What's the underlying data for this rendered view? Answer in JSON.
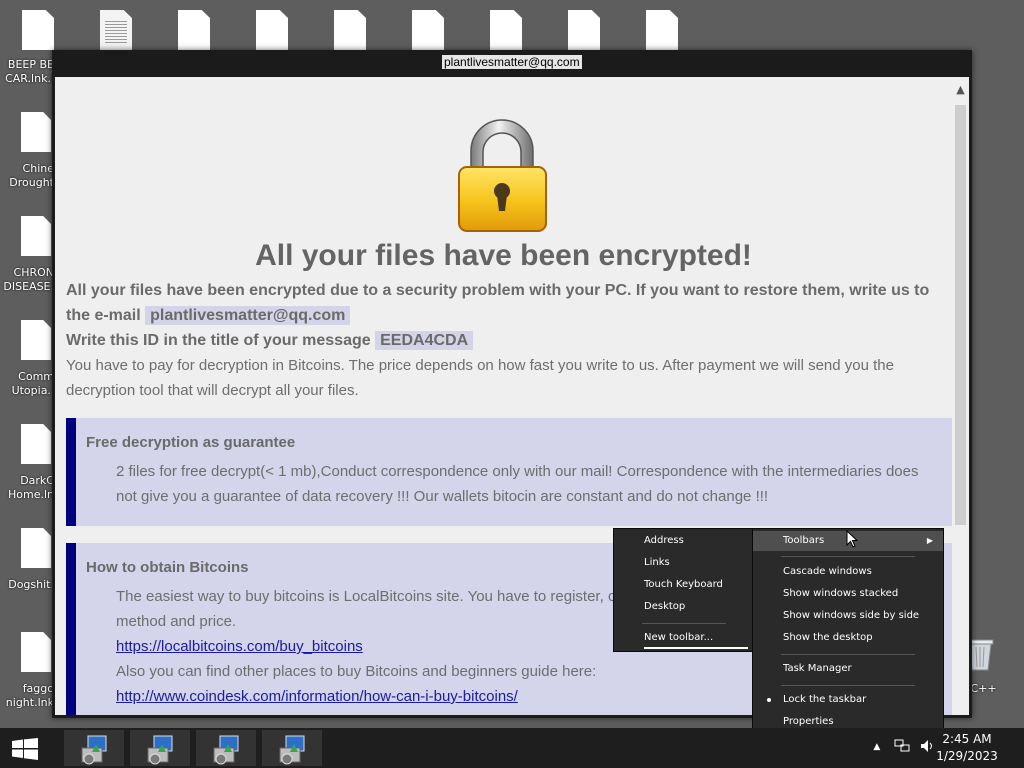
{
  "desktop": {
    "left_labels": [
      "BEEP BE\nCAR.lnk.l",
      "Chine\nDrought",
      "CHRON\nDISEASE.",
      "Comm\nUtopia.l",
      "DarkC\nHome.ln",
      "Dogshit.",
      "faggo\nnight.lnk"
    ],
    "recycle_label": "n C++"
  },
  "window": {
    "title": "plantlivesmatter@qq.com",
    "heading": "All your files have been encrypted!",
    "para1_text": "All your files have been encrypted due to a security problem with your PC. If you want to restore them, write us to the e-mail",
    "email": "plantlivesmatter@qq.com",
    "para2_text": "Write this ID in the title of your message",
    "id": "EEDA4CDA",
    "para3": "You have to pay for decryption in Bitcoins. The price depends on how fast you write to us. After payment we will send you the decryption tool that will decrypt all your files.",
    "panel1": {
      "title": "Free decryption as guarantee",
      "body": "2 files for free decrypt(< 1 mb),Conduct correspondence only with our mail! Correspondence with the intermediaries does not give you a guarantee of data recovery !!! Our wallets bitocin are constant and do not change !!!"
    },
    "panel2": {
      "title": "How to obtain Bitcoins",
      "line1": "The easiest way to buy bitcoins is LocalBitcoins site. You have to register, cl",
      "line2": "method and price.",
      "link1": "https://localbitcoins.com/buy_bitcoins",
      "line3": "Also you can find other places to buy Bitcoins and beginners guide here:",
      "link2": "http://www.coindesk.com/information/how-can-i-buy-bitcoins/"
    }
  },
  "toolbars_submenu": {
    "items": [
      "Address",
      "Links",
      "Touch Keyboard",
      "Desktop"
    ],
    "new_toolbar": "New toolbar..."
  },
  "taskbar_menu": {
    "toolbars": "Toolbars",
    "cascade": "Cascade windows",
    "stacked": "Show windows stacked",
    "side_by_side": "Show windows side by side",
    "show_desktop": "Show the desktop",
    "task_manager": "Task Manager",
    "lock": "Lock the taskbar",
    "properties": "Properties"
  },
  "taskbar": {
    "time": "2:45 AM",
    "date": "1/29/2023",
    "tray_icons": [
      "chevron-up-icon",
      "network-icon",
      "volume-icon"
    ]
  },
  "colors": {
    "panel_bg": "#d4d4ea",
    "panel_bar": "#00007d",
    "link": "#1a1aa6",
    "menu_bg": "#2a2a2a"
  }
}
